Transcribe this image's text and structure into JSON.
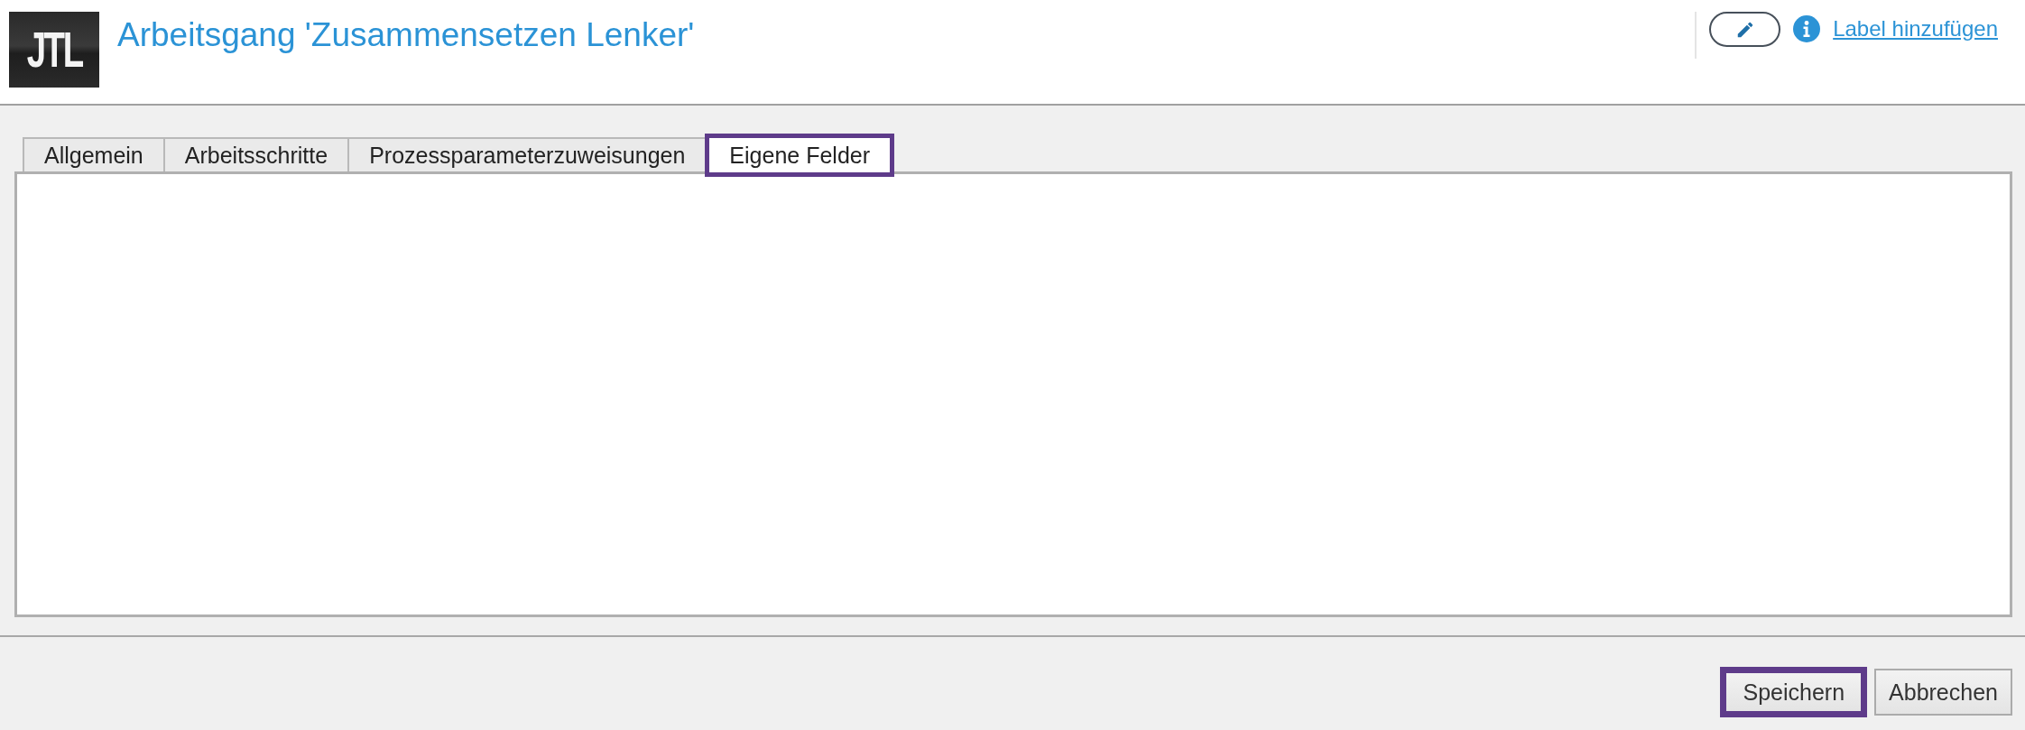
{
  "header": {
    "logo": "JTL",
    "title": "Arbeitsgang 'Zusammensetzen Lenker'",
    "label_link": "Label hinzufügen"
  },
  "tabs": [
    {
      "label": "Allgemein",
      "selected": false,
      "highlighted": false
    },
    {
      "label": "Arbeitsschritte",
      "selected": false,
      "highlighted": false
    },
    {
      "label": "Prozessparameterzuweisungen",
      "selected": false,
      "highlighted": false
    },
    {
      "label": "Eigene Felder",
      "selected": true,
      "highlighted": true
    }
  ],
  "buttons": [
    {
      "label": "Speichern",
      "highlighted": true
    },
    {
      "label": "Abbrechen",
      "highlighted": false
    }
  ]
}
